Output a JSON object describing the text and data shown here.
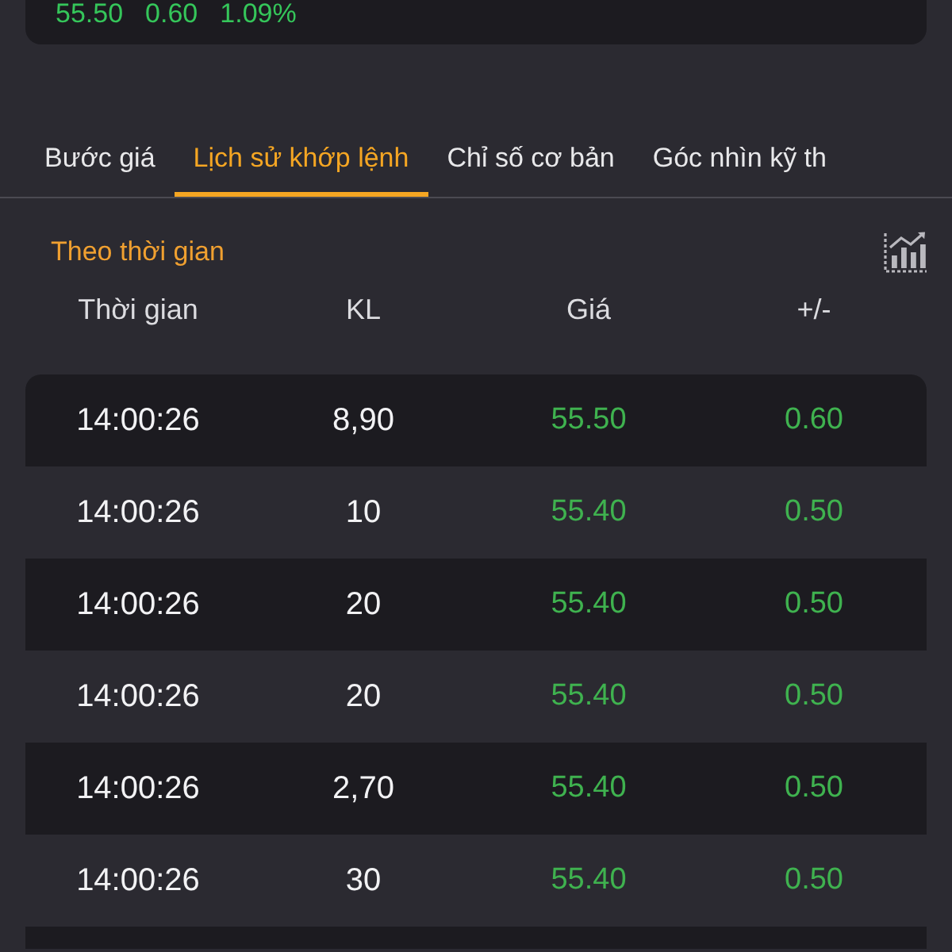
{
  "quote": {
    "price": "55.50",
    "change": "0.60",
    "change_percent": "1.09%"
  },
  "tabs": [
    {
      "label": "Bước giá",
      "selected": false
    },
    {
      "label": "Lịch sử khớp lệnh",
      "selected": true
    },
    {
      "label": "Chỉ số cơ bản",
      "selected": false
    },
    {
      "label": "Góc nhìn kỹ th",
      "selected": false
    }
  ],
  "section": {
    "title": "Theo thời gian"
  },
  "table": {
    "columns": [
      "Thời gian",
      "KL",
      "Giá",
      "+/-"
    ],
    "rows": [
      {
        "time": "14:00:26",
        "volume": "8,90",
        "price": "55.50",
        "change": "0.60"
      },
      {
        "time": "14:00:26",
        "volume": "10",
        "price": "55.40",
        "change": "0.50"
      },
      {
        "time": "14:00:26",
        "volume": "20",
        "price": "55.40",
        "change": "0.50"
      },
      {
        "time": "14:00:26",
        "volume": "20",
        "price": "55.40",
        "change": "0.50"
      },
      {
        "time": "14:00:26",
        "volume": "2,70",
        "price": "55.40",
        "change": "0.50"
      },
      {
        "time": "14:00:26",
        "volume": "30",
        "price": "55.40",
        "change": "0.50"
      }
    ]
  }
}
